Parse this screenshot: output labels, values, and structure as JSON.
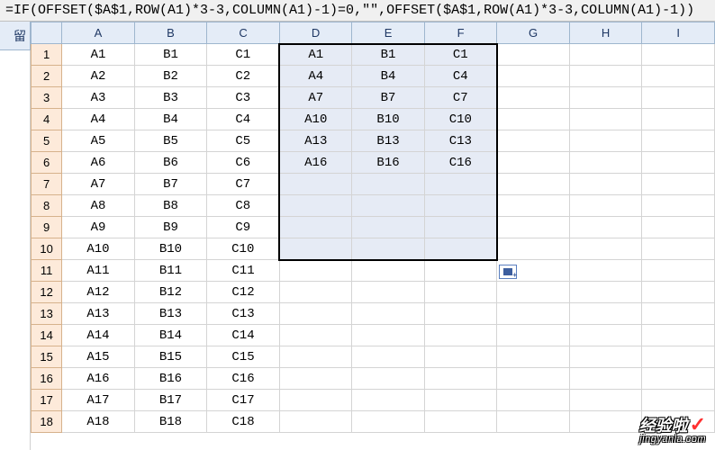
{
  "formula": "=IF(OFFSET($A$1,ROW(A1)*3-3,COLUMN(A1)-1)=0,\"\",OFFSET($A$1,ROW(A1)*3-3,COLUMN(A1)-1))",
  "stub_label": "留",
  "columns": [
    "A",
    "B",
    "C",
    "D",
    "E",
    "F",
    "G",
    "H",
    "I"
  ],
  "rows": [
    {
      "n": "1",
      "cells": [
        "A1",
        "B1",
        "C1",
        "A1",
        "B1",
        "C1",
        "",
        "",
        ""
      ]
    },
    {
      "n": "2",
      "cells": [
        "A2",
        "B2",
        "C2",
        "A4",
        "B4",
        "C4",
        "",
        "",
        ""
      ]
    },
    {
      "n": "3",
      "cells": [
        "A3",
        "B3",
        "C3",
        "A7",
        "B7",
        "C7",
        "",
        "",
        ""
      ]
    },
    {
      "n": "4",
      "cells": [
        "A4",
        "B4",
        "C4",
        "A10",
        "B10",
        "C10",
        "",
        "",
        ""
      ]
    },
    {
      "n": "5",
      "cells": [
        "A5",
        "B5",
        "C5",
        "A13",
        "B13",
        "C13",
        "",
        "",
        ""
      ]
    },
    {
      "n": "6",
      "cells": [
        "A6",
        "B6",
        "C6",
        "A16",
        "B16",
        "C16",
        "",
        "",
        ""
      ]
    },
    {
      "n": "7",
      "cells": [
        "A7",
        "B7",
        "C7",
        "",
        "",
        "",
        "",
        "",
        ""
      ]
    },
    {
      "n": "8",
      "cells": [
        "A8",
        "B8",
        "C8",
        "",
        "",
        "",
        "",
        "",
        ""
      ]
    },
    {
      "n": "9",
      "cells": [
        "A9",
        "B9",
        "C9",
        "",
        "",
        "",
        "",
        "",
        ""
      ]
    },
    {
      "n": "10",
      "cells": [
        "A10",
        "B10",
        "C10",
        "",
        "",
        "",
        "",
        "",
        ""
      ]
    },
    {
      "n": "11",
      "cells": [
        "A11",
        "B11",
        "C11",
        "",
        "",
        "",
        "",
        "",
        ""
      ]
    },
    {
      "n": "12",
      "cells": [
        "A12",
        "B12",
        "C12",
        "",
        "",
        "",
        "",
        "",
        ""
      ]
    },
    {
      "n": "13",
      "cells": [
        "A13",
        "B13",
        "C13",
        "",
        "",
        "",
        "",
        "",
        ""
      ]
    },
    {
      "n": "14",
      "cells": [
        "A14",
        "B14",
        "C14",
        "",
        "",
        "",
        "",
        "",
        ""
      ]
    },
    {
      "n": "15",
      "cells": [
        "A15",
        "B15",
        "C15",
        "",
        "",
        "",
        "",
        "",
        ""
      ]
    },
    {
      "n": "16",
      "cells": [
        "A16",
        "B16",
        "C16",
        "",
        "",
        "",
        "",
        "",
        ""
      ]
    },
    {
      "n": "17",
      "cells": [
        "A17",
        "B17",
        "C17",
        "",
        "",
        "",
        "",
        "",
        ""
      ]
    },
    {
      "n": "18",
      "cells": [
        "A18",
        "B18",
        "C18",
        "",
        "",
        "",
        "",
        "",
        ""
      ]
    }
  ],
  "selection": {
    "row_start": 1,
    "row_end": 10,
    "col_start": 3,
    "col_end": 5
  },
  "watermark": {
    "line1": "经验啦",
    "line2": "jingyanla.com"
  }
}
